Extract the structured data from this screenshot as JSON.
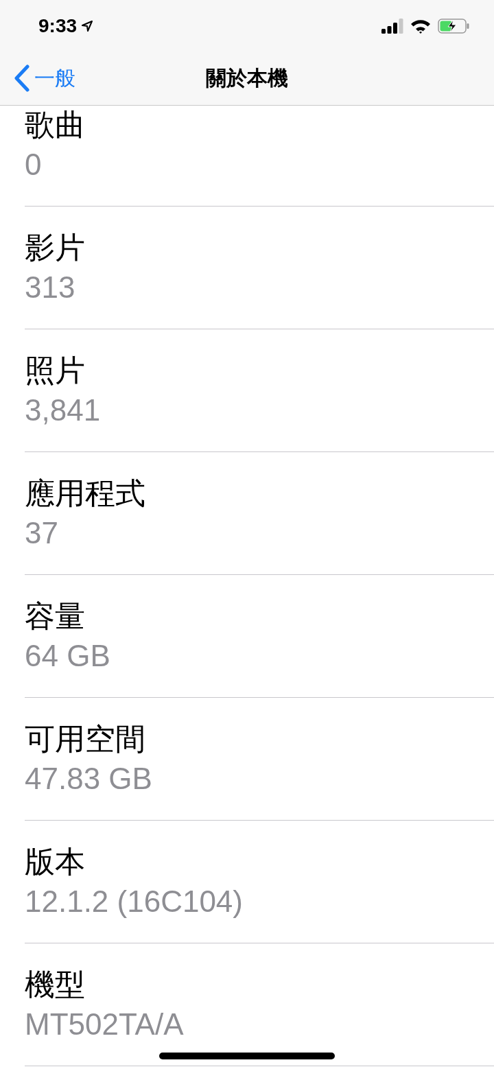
{
  "status_bar": {
    "time": "9:33"
  },
  "nav_bar": {
    "back": "一般",
    "title": "關於本機"
  },
  "rows": [
    {
      "label": "歌曲",
      "value": "0"
    },
    {
      "label": "影片",
      "value": "313"
    },
    {
      "label": "照片",
      "value": "3,841"
    },
    {
      "label": "應用程式",
      "value": "37"
    },
    {
      "label": "容量",
      "value": "64 GB"
    },
    {
      "label": "可用空間",
      "value": "47.83 GB"
    },
    {
      "label": "版本",
      "value": "12.1.2 (16C104)"
    },
    {
      "label": "機型",
      "value": "MT502TA/A"
    }
  ]
}
